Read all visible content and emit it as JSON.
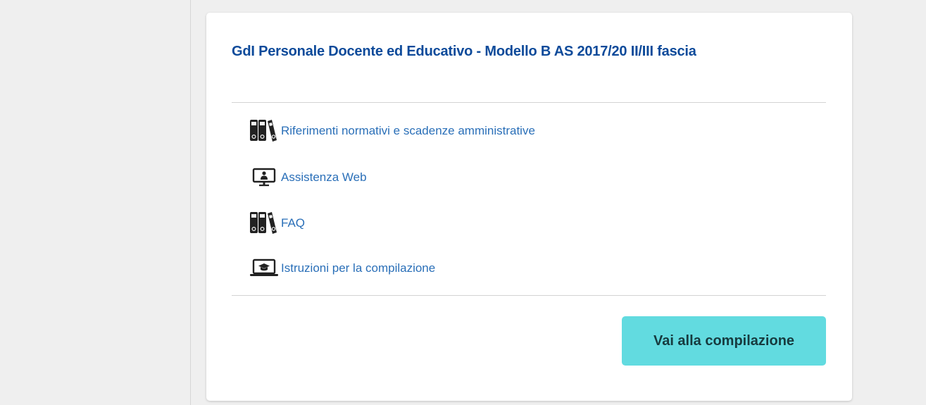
{
  "card": {
    "title": "GdI Personale Docente ed Educativo - Modello B AS 2017/20 II/III fascia",
    "links": [
      {
        "label": "Riferimenti normativi e scadenze amministrative",
        "icon": "binders-icon"
      },
      {
        "label": "Assistenza Web",
        "icon": "monitor-user-icon"
      },
      {
        "label": "FAQ",
        "icon": "binders-icon"
      },
      {
        "label": "Istruzioni per la compilazione",
        "icon": "laptop-graduation-icon"
      }
    ],
    "action_button": "Vai alla compilazione"
  },
  "colors": {
    "title": "#0d4a9a",
    "link": "#2a6fb8",
    "button": "#62dbe0",
    "button_text": "#173b3f",
    "background": "#efefef"
  }
}
